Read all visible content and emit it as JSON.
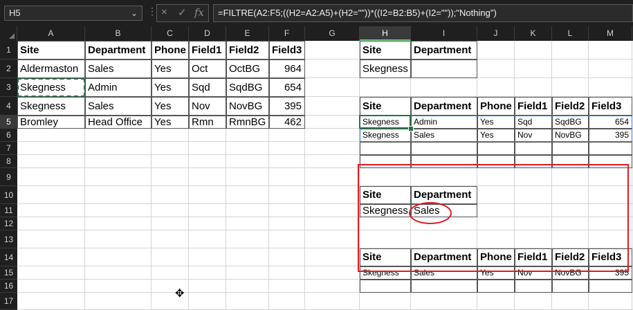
{
  "formula_bar": {
    "name_box": "H5",
    "cancel_icon": "×",
    "enter_icon": "✓",
    "fx_icon": "fx",
    "formula": "=FILTRE(A2:F5;((H2=A2:A5)+(H2=\"\"))*((I2=B2:B5)+(I2=\"\"));\"Nothing\")"
  },
  "columns": [
    "A",
    "B",
    "C",
    "D",
    "E",
    "F",
    "G",
    "H",
    "I",
    "J",
    "K",
    "L",
    "M"
  ],
  "rows": [
    "1",
    "2",
    "3",
    "4",
    "5",
    "6",
    "7",
    "8",
    "9",
    "10",
    "11",
    "12",
    "13",
    "14",
    "15",
    "16",
    "17"
  ],
  "selected_cell": {
    "column": "H",
    "row": "5"
  },
  "source_table": {
    "headers": [
      "Site",
      "Department",
      "Phone",
      "Field1",
      "Field2",
      "Field3"
    ],
    "rows": [
      [
        "Aldermaston",
        "Sales",
        "Yes",
        "Oct",
        "OctBG",
        "964"
      ],
      [
        "Skegness",
        "Admin",
        "Yes",
        "Sqd",
        "SqdBG",
        "654"
      ],
      [
        "Skegness",
        "Sales",
        "Yes",
        "Nov",
        "NovBG",
        "395"
      ],
      [
        "Bromley",
        "Head Office",
        "Yes",
        "Rmn",
        "RmnBG",
        "462"
      ]
    ]
  },
  "criteria_1": {
    "headers": [
      "Site",
      "Department"
    ],
    "values": [
      "Skegness",
      ""
    ]
  },
  "result_1": {
    "headers": [
      "Site",
      "Department",
      "Phone",
      "Field1",
      "Field2",
      "Field3"
    ],
    "rows": [
      [
        "Skegness",
        "Admin",
        "Yes",
        "Sqd",
        "SqdBG",
        "654"
      ],
      [
        "Skegness",
        "Sales",
        "Yes",
        "Nov",
        "NovBG",
        "395"
      ]
    ]
  },
  "criteria_2": {
    "headers": [
      "Site",
      "Department"
    ],
    "values": [
      "Skegness",
      "Sales"
    ]
  },
  "result_2": {
    "headers": [
      "Site",
      "Department",
      "Phone",
      "Field1",
      "Field2",
      "Field3"
    ],
    "rows": [
      [
        "Skegness",
        "Sales",
        "Yes",
        "Nov",
        "NovBG",
        "395"
      ]
    ]
  },
  "colors": {
    "selection": "#217346",
    "highlight": "#e0191f",
    "spill": "#3b78d8"
  }
}
